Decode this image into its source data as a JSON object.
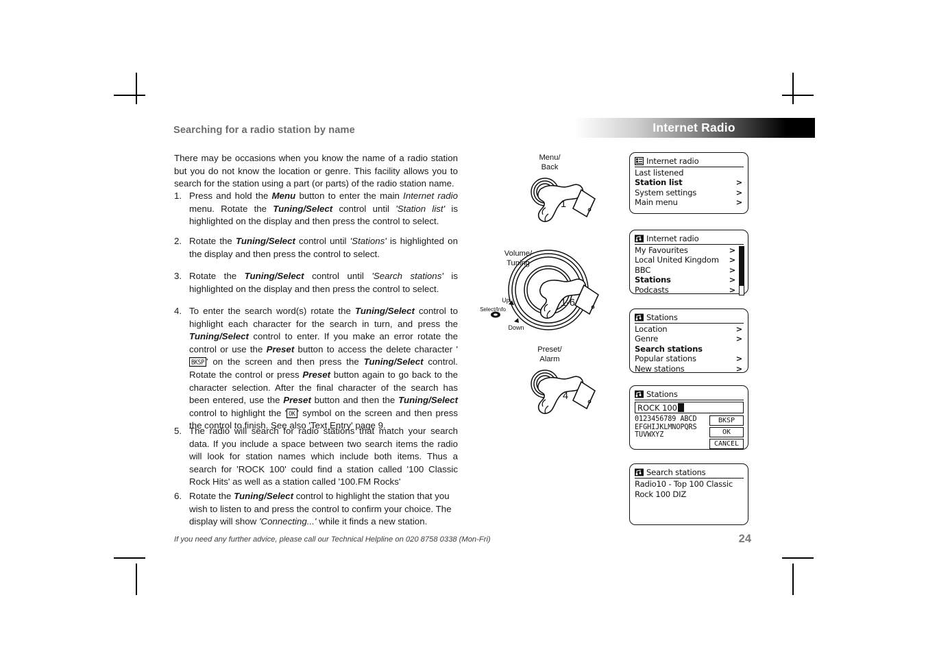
{
  "header": {
    "title": "Internet Radio"
  },
  "section": {
    "title": "Searching for a radio station by name",
    "intro": "There may be occasions when you know the name of a radio station but you do not know the location or genre. This facility allows you to search for the station using a part (or parts) of the radio station name."
  },
  "steps": [
    {
      "num": "1.",
      "html": "Press and hold the <b class='bi'>Menu</b> button to enter the main <i class='it'>Internet radio</i> menu. Rotate the <b class='bi'>Tuning/Select</b> control until <i class='it'>'Station list'</i> is highlighted on the display and then press the control to select."
    },
    {
      "num": "2.",
      "html": "Rotate the <b class='bi'>Tuning/Select</b> control until <i class='it'>'Stations'</i> is highlighted on the display and then press the control to select."
    },
    {
      "num": "3.",
      "html": "Rotate the <b class='bi'>Tuning/Select</b> control until <i class='it'>'Search stations'</i> is highlighted on the display and then press the control to select."
    },
    {
      "num": "4.",
      "html": "To enter the search word(s) rotate the <b class='bi'>Tuning/Select</b> control to highlight each character for the search in turn, and press the <b class='bi'>Tuning/Select</b> control to enter. If you make an error rotate the control or use the <b class='bi'>Preset</b> button to access the delete character '<span class='keyglyph'>BKSP</span>' on the screen and then press the <b class='bi'>Tuning/Select</b> control. Rotate the control or press <b class='bi'>Preset</b> button again to go back to the character selection. After the final character of the search has been entered, use the <b class='bi'>Preset</b> button and then the <b class='bi'>Tuning/Select</b> control to highlight the '<span class='keyglyph'>OK</span>' symbol on the screen and then press the control to finish. See also 'Text Entry' page 9."
    },
    {
      "num": "5.",
      "html": "The radio will search for radio stations that match your search data. If you include a space between two search items the radio will look for station names which include both items. Thus a search for 'ROCK 100' could find a station called '100 Classic Rock Hits' as well as a station called '100.FM Rocks'"
    },
    {
      "num": "6.",
      "html": "Rotate the <b class='bi'>Tuning/Select</b> control to highlight the station that you wish to listen to and press the control to confirm your choice. The display will show <i class='it'>'Connecting...'</i> while it finds a new station."
    }
  ],
  "footer": {
    "note": "If you need any further advice, please call our Technical Helpline on 020 8758 0338 (Mon-Fri)",
    "page": "24"
  },
  "diagrams": [
    {
      "label": "Menu/\nBack",
      "number": "1"
    },
    {
      "label": "Volume/\nTuning",
      "number": "1-6",
      "up": "Up",
      "down": "Down",
      "select": "Select/Info"
    },
    {
      "label": "Preset/\nAlarm",
      "number": "4"
    }
  ],
  "screens": {
    "screen1": {
      "icon": "list-icon",
      "title": "Internet radio",
      "rows": [
        {
          "label": "Last listened",
          "arrow": "",
          "selected": false
        },
        {
          "label": "Station list",
          "arrow": ">",
          "selected": true
        },
        {
          "label": "System settings",
          "arrow": ">",
          "selected": false
        },
        {
          "label": "Main menu",
          "arrow": ">",
          "selected": false
        }
      ]
    },
    "screen2": {
      "icon": "internet-radio-icon",
      "title": "Internet radio",
      "rows": [
        {
          "label": "My Favourites",
          "arrow": ">",
          "selected": false
        },
        {
          "label": "Local United Kingdom",
          "arrow": ">",
          "selected": false
        },
        {
          "label": "BBC",
          "arrow": ">",
          "selected": false
        },
        {
          "label": "Stations",
          "arrow": ">",
          "selected": true
        },
        {
          "label": "Podcasts",
          "arrow": ">",
          "selected": false
        }
      ],
      "scrollbar": true
    },
    "screen3": {
      "icon": "internet-radio-icon",
      "title": "Stations",
      "rows": [
        {
          "label": "Location",
          "arrow": ">",
          "selected": false
        },
        {
          "label": "Genre",
          "arrow": ">",
          "selected": false
        },
        {
          "label": "Search stations",
          "arrow": "",
          "selected": true
        },
        {
          "label": "Popular stations",
          "arrow": ">",
          "selected": false
        },
        {
          "label": "New stations",
          "arrow": ">",
          "selected": false
        }
      ]
    },
    "screen4": {
      "icon": "internet-radio-icon",
      "title": "Stations",
      "entry_value": "ROCK 100",
      "char_rows": "0123456789 ABCD\nEFGHIJKLMNOPQRS\nTUVWXYZ",
      "keys": [
        "BKSP",
        "OK",
        "CANCEL"
      ]
    },
    "screen5": {
      "icon": "internet-radio-icon",
      "title": "Search stations",
      "result_line1": "Radio10 - Top 100 Classic",
      "result_line2": "Rock 100 DIZ"
    }
  },
  "colors": {
    "section_title": "#6d6d6d",
    "page_number": "#7a7a7a",
    "header_text": "#ffffff",
    "lcd_fg": "#111111",
    "lcd_bg": "#ffffff"
  }
}
